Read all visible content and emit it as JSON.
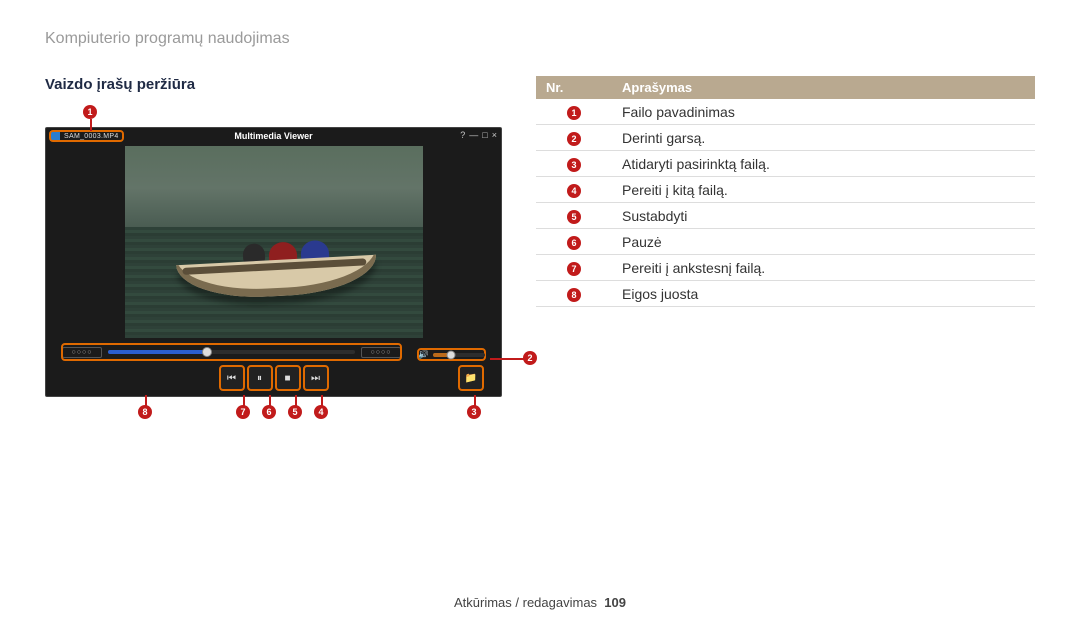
{
  "chapter_title": "Kompiuterio programų naudojimas",
  "section_title": "Vaizdo įrašų peržiūra",
  "player": {
    "app_title": "Multimedia Viewer",
    "filename": "SAM_0003.MP4",
    "win_controls": {
      "help": "?",
      "min": "—",
      "max": "□",
      "close": "×"
    }
  },
  "table": {
    "headers": {
      "nr": "Nr.",
      "desc": "Aprašymas"
    },
    "rows": [
      {
        "n": "1",
        "text": "Failo pavadinimas"
      },
      {
        "n": "2",
        "text": "Derinti garsą."
      },
      {
        "n": "3",
        "text": "Atidaryti pasirinktą failą."
      },
      {
        "n": "4",
        "text": "Pereiti į kitą failą."
      },
      {
        "n": "5",
        "text": "Sustabdyti"
      },
      {
        "n": "6",
        "text": "Pauzė"
      },
      {
        "n": "7",
        "text": "Pereiti į ankstesnį failą."
      },
      {
        "n": "8",
        "text": "Eigos juosta"
      }
    ]
  },
  "callouts": {
    "c1": "1",
    "c2": "2",
    "c3": "3",
    "c4": "4",
    "c5": "5",
    "c6": "6",
    "c7": "7",
    "c8": "8"
  },
  "icons": {
    "prev": "⏮",
    "pause": "⏸",
    "stop": "■",
    "next": "⏭",
    "folder": "📁",
    "speaker": "🔊"
  },
  "footer": {
    "section": "Atkūrimas / redagavimas",
    "page": "109"
  }
}
